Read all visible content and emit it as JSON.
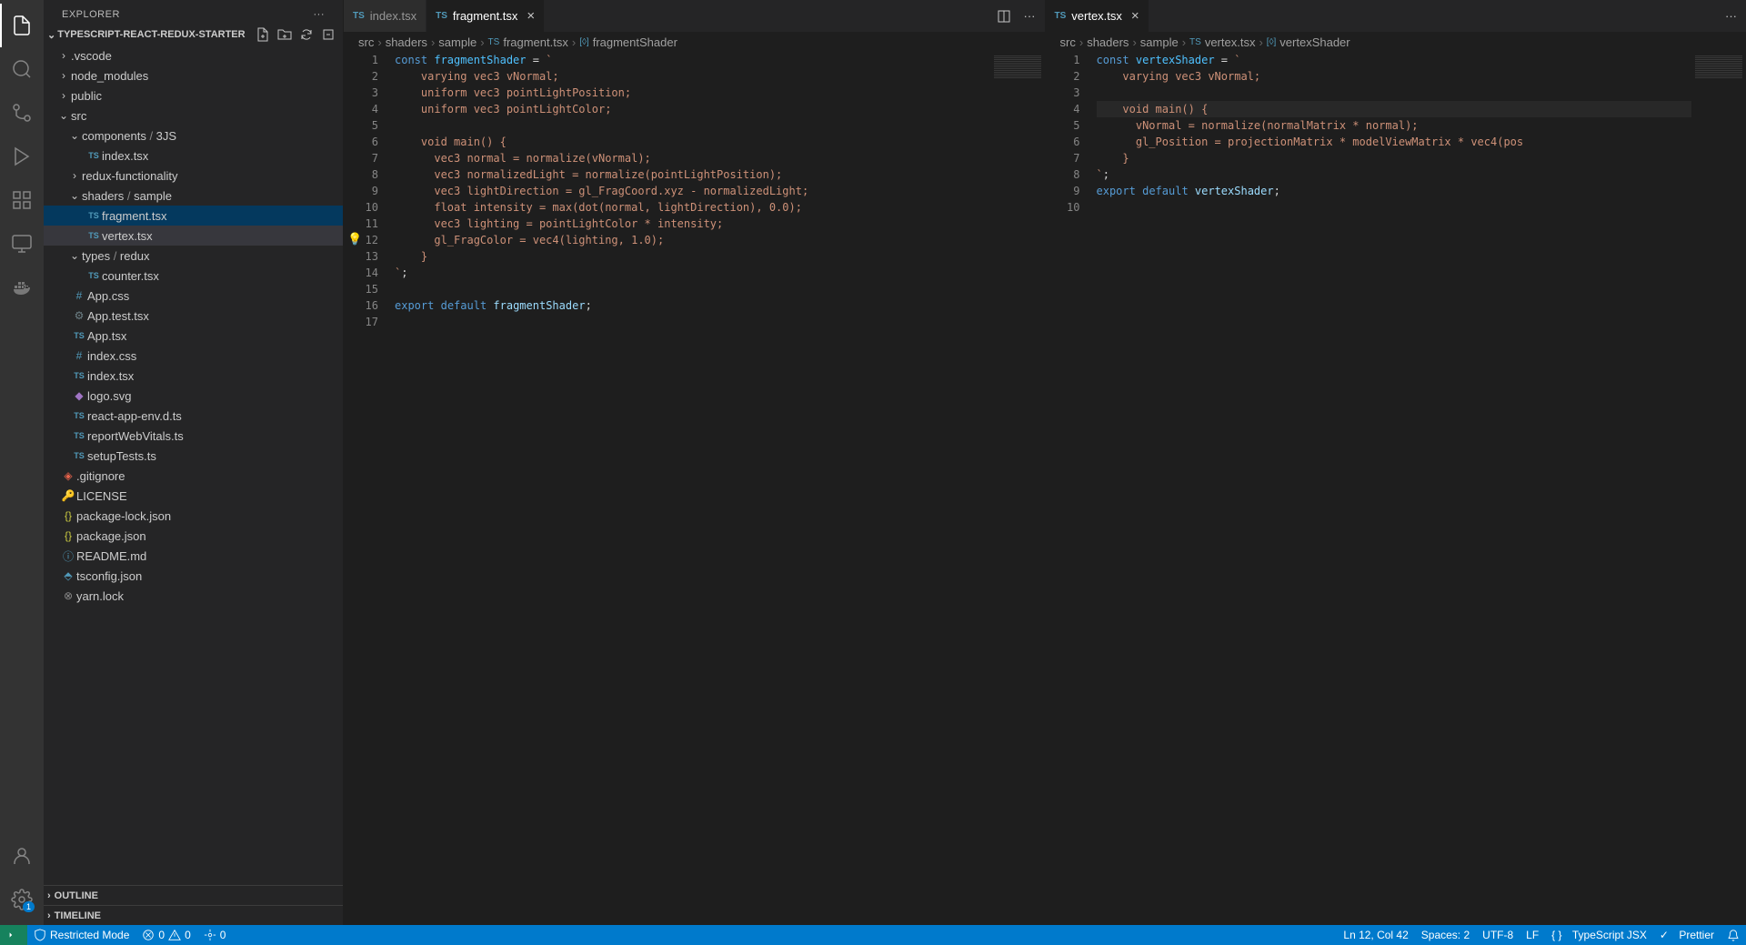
{
  "sidebar": {
    "title": "EXPLORER",
    "project": "TYPESCRIPT-REACT-REDUX-STARTER",
    "outline": "OUTLINE",
    "timeline": "TIMELINE"
  },
  "tree": {
    "folders": {
      "vscode": ".vscode",
      "node_modules": "node_modules",
      "public": "public",
      "src": "src",
      "components": "components",
      "components_sub": "3JS",
      "redux_func": "redux-functionality",
      "shaders": "shaders",
      "shaders_sub": "sample",
      "types": "types",
      "types_sub": "redux"
    },
    "files": {
      "comp_index": "index.tsx",
      "fragment": "fragment.tsx",
      "vertex": "vertex.tsx",
      "counter": "counter.tsx",
      "appcss": "App.css",
      "apptest": "App.test.tsx",
      "apptsx": "App.tsx",
      "indexcss": "index.css",
      "indextsx": "index.tsx",
      "logosvg": "logo.svg",
      "reactenv": "react-app-env.d.ts",
      "reportweb": "reportWebVitals.ts",
      "setuptests": "setupTests.ts",
      "gitignore": ".gitignore",
      "license": "LICENSE",
      "pkglock": "package-lock.json",
      "pkg": "package.json",
      "readme": "README.md",
      "tsconfig": "tsconfig.json",
      "yarn": "yarn.lock"
    }
  },
  "tabs": {
    "left": [
      {
        "label": "index.tsx",
        "active": false,
        "closeable": false
      },
      {
        "label": "fragment.tsx",
        "active": true,
        "closeable": true
      }
    ],
    "right": [
      {
        "label": "vertex.tsx",
        "active": true,
        "closeable": true
      }
    ]
  },
  "breadcrumbs": {
    "left": {
      "p0": "src",
      "p1": "shaders",
      "p2": "sample",
      "p3": "fragment.tsx",
      "p4": "fragmentShader"
    },
    "right": {
      "p0": "src",
      "p1": "shaders",
      "p2": "sample",
      "p3": "vertex.tsx",
      "p4": "vertexShader"
    }
  },
  "editor_left": {
    "lines": 17,
    "bulb_line": 12,
    "code": [
      [
        [
          "kw",
          "const"
        ],
        [
          "sp",
          " "
        ],
        [
          "const",
          "fragmentShader"
        ],
        [
          "sp",
          " "
        ],
        [
          "op",
          "="
        ],
        [
          "sp",
          " "
        ],
        [
          "str",
          "`"
        ]
      ],
      [
        [
          "sp",
          "    "
        ],
        [
          "str",
          "varying vec3 vNormal;"
        ]
      ],
      [
        [
          "sp",
          "    "
        ],
        [
          "str",
          "uniform vec3 pointLightPosition;"
        ]
      ],
      [
        [
          "sp",
          "    "
        ],
        [
          "str",
          "uniform vec3 pointLightColor;"
        ]
      ],
      [],
      [
        [
          "sp",
          "    "
        ],
        [
          "str",
          "void main() {"
        ]
      ],
      [
        [
          "sp",
          "      "
        ],
        [
          "str",
          "vec3 normal = normalize(vNormal);"
        ]
      ],
      [
        [
          "sp",
          "      "
        ],
        [
          "str",
          "vec3 normalizedLight = normalize(pointLightPosition);"
        ]
      ],
      [
        [
          "sp",
          "      "
        ],
        [
          "str",
          "vec3 lightDirection = gl_FragCoord.xyz - normalizedLight;"
        ]
      ],
      [
        [
          "sp",
          "      "
        ],
        [
          "str",
          "float intensity = max(dot(normal, lightDirection), 0.0);"
        ]
      ],
      [
        [
          "sp",
          "      "
        ],
        [
          "str",
          "vec3 lighting = pointLightColor * intensity;"
        ]
      ],
      [
        [
          "sp",
          "      "
        ],
        [
          "str",
          "gl_FragColor = vec4(lighting, 1.0);"
        ]
      ],
      [
        [
          "sp",
          "    "
        ],
        [
          "str",
          "}"
        ]
      ],
      [
        [
          "str",
          "`"
        ],
        [
          "pun",
          ";"
        ]
      ],
      [],
      [
        [
          "kw",
          "export"
        ],
        [
          "sp",
          " "
        ],
        [
          "kw",
          "default"
        ],
        [
          "sp",
          " "
        ],
        [
          "var",
          "fragmentShader"
        ],
        [
          "pun",
          ";"
        ]
      ],
      []
    ]
  },
  "editor_right": {
    "lines": 10,
    "highlight_line": 4,
    "code": [
      [
        [
          "kw",
          "const"
        ],
        [
          "sp",
          " "
        ],
        [
          "const",
          "vertexShader"
        ],
        [
          "sp",
          " "
        ],
        [
          "op",
          "="
        ],
        [
          "sp",
          " "
        ],
        [
          "str",
          "`"
        ]
      ],
      [
        [
          "sp",
          "    "
        ],
        [
          "str",
          "varying vec3 vNormal;"
        ]
      ],
      [],
      [
        [
          "sp",
          "    "
        ],
        [
          "str",
          "void main() {"
        ]
      ],
      [
        [
          "sp",
          "      "
        ],
        [
          "str",
          "vNormal = normalize(normalMatrix * normal);"
        ]
      ],
      [
        [
          "sp",
          "      "
        ],
        [
          "str",
          "gl_Position = projectionMatrix * modelViewMatrix * vec4(pos"
        ]
      ],
      [
        [
          "sp",
          "    "
        ],
        [
          "str",
          "}"
        ]
      ],
      [
        [
          "str",
          "`"
        ],
        [
          "pun",
          ";"
        ]
      ],
      [
        [
          "kw",
          "export"
        ],
        [
          "sp",
          " "
        ],
        [
          "kw",
          "default"
        ],
        [
          "sp",
          " "
        ],
        [
          "var",
          "vertexShader"
        ],
        [
          "pun",
          ";"
        ]
      ],
      []
    ]
  },
  "status": {
    "restricted": "Restricted Mode",
    "errors": "0",
    "warnings": "0",
    "ports": "0",
    "ln_col": "Ln 12, Col 42",
    "spaces": "Spaces: 2",
    "encoding": "UTF-8",
    "eol": "LF",
    "lang": "TypeScript JSX",
    "prettier": "Prettier"
  },
  "settings_badge": "1"
}
